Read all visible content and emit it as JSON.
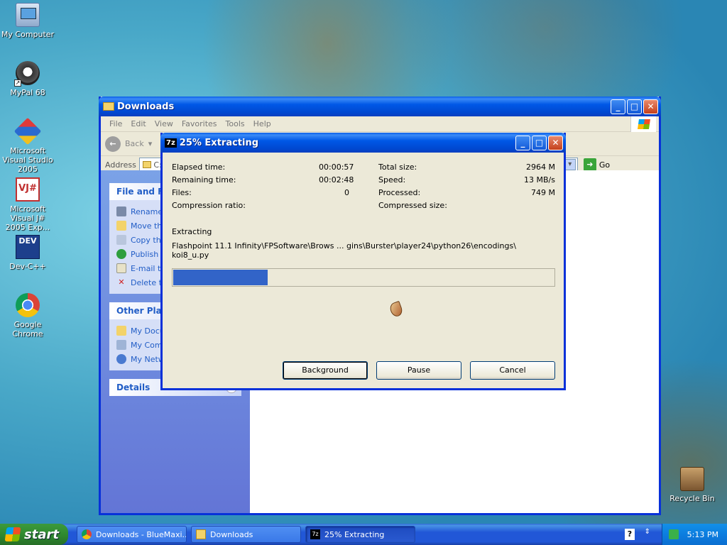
{
  "desktop": {
    "icons": [
      {
        "label": "My Computer",
        "icon": "computer-icon"
      },
      {
        "label": "MyPal 68",
        "icon": "racoon-icon"
      },
      {
        "label": "Microsoft Visual Studio 2005",
        "icon": "visual-studio-icon"
      },
      {
        "label": "Microsoft Visual J# 2005 Exp...",
        "icon": "visual-j-icon"
      },
      {
        "label": "Dev-C++",
        "icon": "dev-cpp-icon"
      },
      {
        "label": "Google Chrome",
        "icon": "chrome-icon"
      },
      {
        "label": "Recycle Bin",
        "icon": "recycle-bin-icon"
      }
    ],
    "vj_text": "VJ#",
    "dev_text": "DEV"
  },
  "explorer": {
    "title": "Downloads",
    "menu": [
      "File",
      "Edit",
      "View",
      "Favorites",
      "Tools",
      "Help"
    ],
    "back_label": "Back",
    "address_label": "Address",
    "address_value": "C:\\",
    "go_label": "Go",
    "file_tasks": {
      "title": "File and Fo",
      "items": [
        "Rename",
        "Move th",
        "Copy th",
        "Publish",
        "E-mail th",
        "Delete t"
      ]
    },
    "other_places": {
      "title": "Other Place",
      "items": [
        "My Docu",
        "My Com",
        "My Netw"
      ]
    },
    "details": {
      "title": "Details"
    }
  },
  "dialog": {
    "title": "25% Extracting",
    "app_badge": "7z",
    "stats": {
      "elapsed_label": "Elapsed time:",
      "elapsed_value": "00:00:57",
      "remaining_label": "Remaining time:",
      "remaining_value": "00:02:48",
      "files_label": "Files:",
      "files_value": "0",
      "ratio_label": "Compression ratio:",
      "total_label": "Total size:",
      "total_value": "2964 M",
      "speed_label": "Speed:",
      "speed_value": "13 MB/s",
      "processed_label": "Processed:",
      "processed_value": "749 M",
      "compressed_label": "Compressed size:"
    },
    "status": "Extracting",
    "path_line1": "Flashpoint 11.1 Infinity\\FPSoftware\\Brows ... gins\\Burster\\player24\\python26\\encodings\\",
    "path_line2": "koi8_u.py",
    "progress": 0.25,
    "buttons": {
      "background": "Background",
      "pause": "Pause",
      "cancel": "Cancel"
    }
  },
  "taskbar": {
    "start_label": "start",
    "tasks": [
      {
        "label": "Downloads - BlueMaxi...",
        "icon": "chrome-icon"
      },
      {
        "label": "Downloads",
        "icon": "folder-icon"
      },
      {
        "label": "25% Extracting",
        "icon": "7zip-icon",
        "active": true
      }
    ],
    "clock": "5:13 PM"
  },
  "colors": {
    "xp_blue": "#0831d9",
    "progress": "#3264c8",
    "desk_sea": "#3b98c2"
  }
}
